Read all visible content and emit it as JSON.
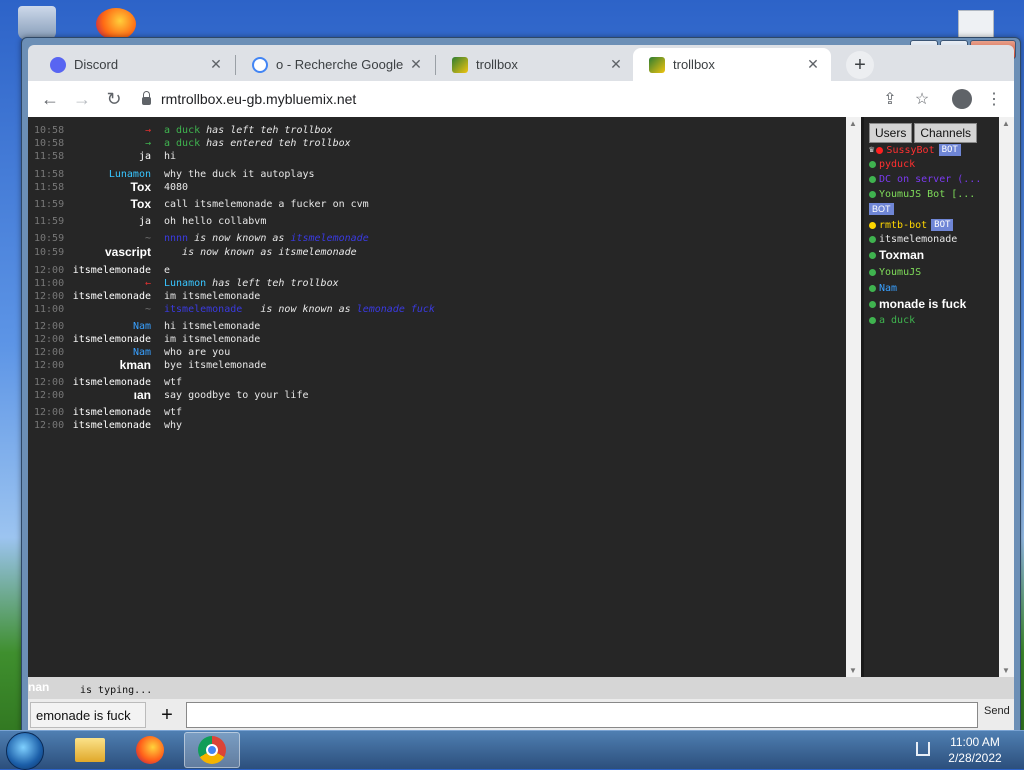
{
  "browser": {
    "tabs": [
      {
        "title": "Discord",
        "favicon": "discord-icon",
        "active": false
      },
      {
        "title": "o - Recherche Google",
        "favicon": "google-icon",
        "active": false
      },
      {
        "title": "trollbox",
        "favicon": "trollbox-icon",
        "active": false
      },
      {
        "title": "trollbox",
        "favicon": "trollbox-icon",
        "active": true
      }
    ],
    "url": "rmtrollbox.eu-gb.mybluemix.net"
  },
  "chat": {
    "messages": [
      {
        "time": "10:58",
        "nick": "→",
        "nick_color": "#e03030",
        "text_name": "a duck",
        "text_name_color": "#3fb34f",
        "text": " has left teh trollbox",
        "system": true
      },
      {
        "time": "10:58",
        "nick": "→",
        "nick_color": "#3fb34f",
        "text_name": "a duck",
        "text_name_color": "#3fb34f",
        "text": " has entered teh trollbox",
        "system": true
      },
      {
        "time": "11:58",
        "nick": "ja",
        "nick_color": "#ffffff",
        "text": "hi"
      },
      {
        "time": "11:58",
        "nick": "Lunamon",
        "nick_color": "#38c5ff",
        "text": "why the duck it autoplays"
      },
      {
        "time": "11:58",
        "nick": "Tox",
        "nick_color": "#ffffff",
        "nick_bold": true,
        "text": "4080"
      },
      {
        "time": "11:59",
        "nick": "Tox",
        "nick_color": "#ffffff",
        "nick_bold": true,
        "text": "call itsmelemonade a fucker on cvm"
      },
      {
        "time": "11:59",
        "nick": "ja",
        "nick_color": "#ffffff",
        "text": "oh hello collabvm"
      },
      {
        "time": "10:59",
        "nick": "~",
        "nick_color": "#777777",
        "text_name": "nnnn",
        "text_name_color": "#3a3ae0",
        "text": " is now known as ",
        "text_name2": "itsmelemonade",
        "text_name2_color": "#3a3ae0",
        "system": true
      },
      {
        "time": "10:59",
        "nick": "vascript",
        "nick_color": "#ffffff",
        "nick_bold": true,
        "text": "   is now known as itsmelemonade",
        "system": true
      },
      {
        "time": "12:00",
        "nick": "itsmelemonade",
        "nick_color": "#ffffff",
        "text": "e"
      },
      {
        "time": "11:00",
        "nick": "←",
        "nick_color": "#e03030",
        "text_name": "Lunamon",
        "text_name_color": "#38c5ff",
        "text": " has left teh trollbox",
        "system": true
      },
      {
        "time": "12:00",
        "nick": "itsmelemonade",
        "nick_color": "#ffffff",
        "text": "im itsmelemonade"
      },
      {
        "time": "11:00",
        "nick": "~",
        "nick_color": "#777777",
        "text_name": "itsmelemonade",
        "text_name_color": "#3a3ae0",
        "text": "   is now known as ",
        "text_name2": "lemonade fuck",
        "text_name2_color": "#3a3ae0",
        "system": true
      },
      {
        "time": "12:00",
        "nick": "Nam",
        "nick_color": "#38a0ff",
        "text": "hi itsmelemonade"
      },
      {
        "time": "12:00",
        "nick": "itsmelemonade",
        "nick_color": "#ffffff",
        "text": "im itsmelemonade"
      },
      {
        "time": "12:00",
        "nick": "Nam",
        "nick_color": "#38a0ff",
        "text": "who are you"
      },
      {
        "time": "12:00",
        "nick": "kman",
        "nick_color": "#ffffff",
        "nick_bold": true,
        "text": "bye itsmelemonade"
      },
      {
        "time": "12:00",
        "nick": "itsmelemonade",
        "nick_color": "#ffffff",
        "text": "wtf"
      },
      {
        "time": "12:00",
        "nick": "ıan",
        "nick_color": "#ffffff",
        "nick_bold": true,
        "text": "say goodbye to your life"
      },
      {
        "time": "12:00",
        "nick": "itsmelemonade",
        "nick_color": "#ffffff",
        "text": "wtf"
      },
      {
        "time": "12:00",
        "nick": "itsmelemonade",
        "nick_color": "#ffffff",
        "text": "why"
      }
    ]
  },
  "sidebar": {
    "tab_users": "Users",
    "tab_channels": "Channels",
    "users": [
      {
        "name": "SussyBot",
        "color": "#ff3030",
        "dot": "#ff2020",
        "bot": true,
        "crown": true
      },
      {
        "name": "pyduck",
        "color": "#ff3030",
        "dot": "#3fb34f"
      },
      {
        "name": "DC on server (...",
        "color": "#7a3af0",
        "dot": "#3fb34f"
      },
      {
        "name": "YoumuJS Bot [...",
        "color": "#7fdc5a",
        "dot": "#3fb34f",
        "bot": true,
        "bot_below": true
      },
      {
        "name": "rmtb-bot",
        "color": "#ffd700",
        "dot": "#ffd700",
        "bot": true
      },
      {
        "name": "itsmelemonade",
        "color": "#e8e8e8",
        "dot": "#3fb34f"
      },
      {
        "name": "Toxman",
        "color": "#ffffff",
        "dot": "#3fb34f",
        "bold": true
      },
      {
        "name": "YoumuJS",
        "color": "#7fdc5a",
        "dot": "#3fb34f"
      },
      {
        "name": "Nam",
        "color": "#38a0ff",
        "dot": "#3fb34f"
      },
      {
        "name": "monade is fuck",
        "color": "#ffffff",
        "dot": "#3fb34f",
        "bold": true
      },
      {
        "name": "a duck",
        "color": "#3fb34f",
        "dot": "#3fb34f"
      }
    ],
    "bot_label": "BOT"
  },
  "typing": {
    "name": "nan",
    "text": "is typing..."
  },
  "input": {
    "nickname": "emonade is fuck",
    "plus": "+",
    "send": "Send"
  },
  "taskbar": {
    "time": "11:00 AM",
    "date": "2/28/2022"
  }
}
